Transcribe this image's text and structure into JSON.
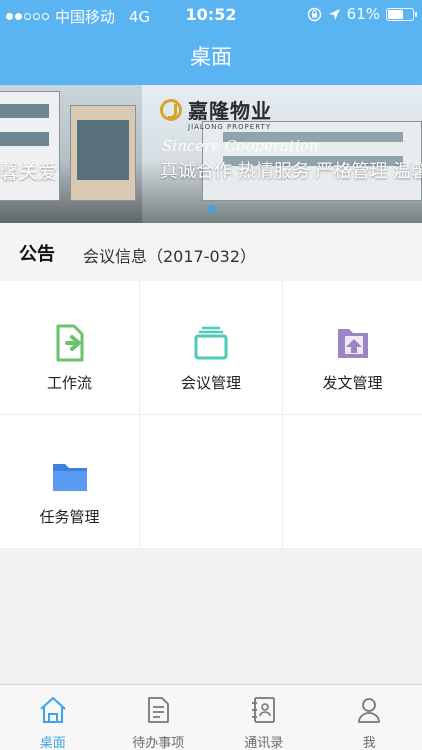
{
  "status_bar": {
    "carrier": "中国移动",
    "network": "4G",
    "time": "10:52",
    "battery": "61%",
    "battery_level": 0.61
  },
  "nav": {
    "title": "桌面"
  },
  "banner": {
    "prev_text": "馨关爱",
    "logo_cn": "嘉隆物业",
    "logo_en": "JIALONG PROPERTY",
    "tagline_en": "Sincere Cooperation",
    "slogan": "真诚合作 热情服务 严格管理 温馨",
    "active_page": 1
  },
  "notice": {
    "label": "公告",
    "text": "会议信息（2017-032）"
  },
  "apps": [
    {
      "label": "工作流",
      "icon": "workflow-icon",
      "color": "#6cc26b"
    },
    {
      "label": "会议管理",
      "icon": "meeting-icon",
      "color": "#4ccbb8"
    },
    {
      "label": "发文管理",
      "icon": "document-upload-icon",
      "color": "#9b86c4"
    },
    {
      "label": "任务管理",
      "icon": "folder-icon",
      "color": "#4a8ef0"
    }
  ],
  "tabs": [
    {
      "label": "桌面",
      "icon": "home-icon",
      "active": true
    },
    {
      "label": "待办事项",
      "icon": "todo-icon",
      "active": false
    },
    {
      "label": "通讯录",
      "icon": "contacts-icon",
      "active": false
    },
    {
      "label": "我",
      "icon": "user-icon",
      "active": false
    }
  ],
  "colors": {
    "primary": "#5ab4f2",
    "accent": "#3aa5ec"
  }
}
